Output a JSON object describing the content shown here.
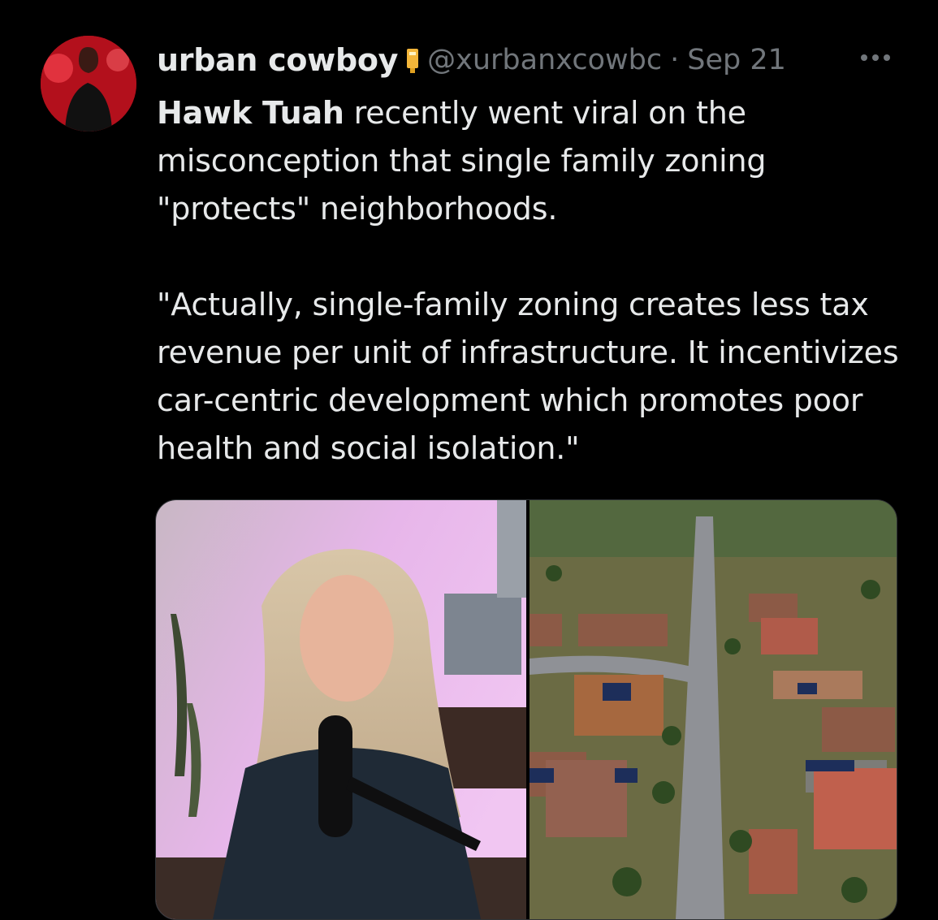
{
  "tweet": {
    "author_name": "urban cowboy",
    "handle": "@xurbanxcowbc",
    "separator": "·",
    "date": "Sep 21",
    "text_bold": "Hawk Tuah",
    "text_line1_rest": " recently went viral on the misconception that single family zoning \"protects\" neighborhoods.",
    "quote": "\"Actually, single-family zoning creates less tax revenue per unit of infrastructure. It incentivizes car-centric development which promotes poor health and social isolation.\""
  },
  "icons": {
    "avatar": "profile-photo",
    "badge": "yellow-badge-icon",
    "more": "more-options-icon"
  },
  "media": {
    "left": "podcast-woman-photo",
    "right": "suburban-aerial-photo"
  },
  "colors": {
    "background": "#000000",
    "text": "#e7e9ea",
    "muted": "#71767b"
  }
}
